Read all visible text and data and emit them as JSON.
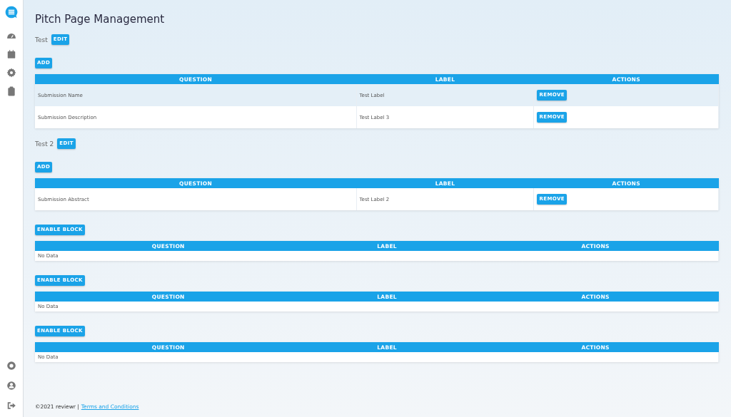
{
  "page_title": "Pitch Page Management",
  "blocks": [
    {
      "kind": "page",
      "name": "Test",
      "edit_button": "EDIT",
      "add_button": "ADD",
      "columns": [
        "QUESTION",
        "LABEL",
        "ACTIONS"
      ],
      "rows": [
        {
          "question": "Submission Name",
          "label": "Test Label",
          "action": "REMOVE",
          "selected": true
        },
        {
          "question": "Submission Description",
          "label": "Test Label 3",
          "action": "REMOVE",
          "selected": false
        }
      ]
    },
    {
      "kind": "page",
      "name": "Test 2",
      "edit_button": "EDIT",
      "add_button": "ADD",
      "columns": [
        "QUESTION",
        "LABEL",
        "ACTIONS"
      ],
      "rows": [
        {
          "question": "Submission Abstract",
          "label": "Test Label 2",
          "action": "REMOVE",
          "selected": false
        }
      ]
    },
    {
      "kind": "disabled",
      "enable_button": "ENABLE BLOCK",
      "columns": [
        "QUESTION",
        "LABEL",
        "ACTIONS"
      ],
      "empty_text": "No Data"
    },
    {
      "kind": "disabled",
      "enable_button": "ENABLE BLOCK",
      "columns": [
        "QUESTION",
        "LABEL",
        "ACTIONS"
      ],
      "empty_text": "No Data"
    },
    {
      "kind": "disabled",
      "enable_button": "ENABLE BLOCK",
      "columns": [
        "QUESTION",
        "LABEL",
        "ACTIONS"
      ],
      "empty_text": "No Data"
    }
  ],
  "footer": {
    "copyright": "©2021 reviewr |",
    "link": "Terms and Conditions"
  }
}
